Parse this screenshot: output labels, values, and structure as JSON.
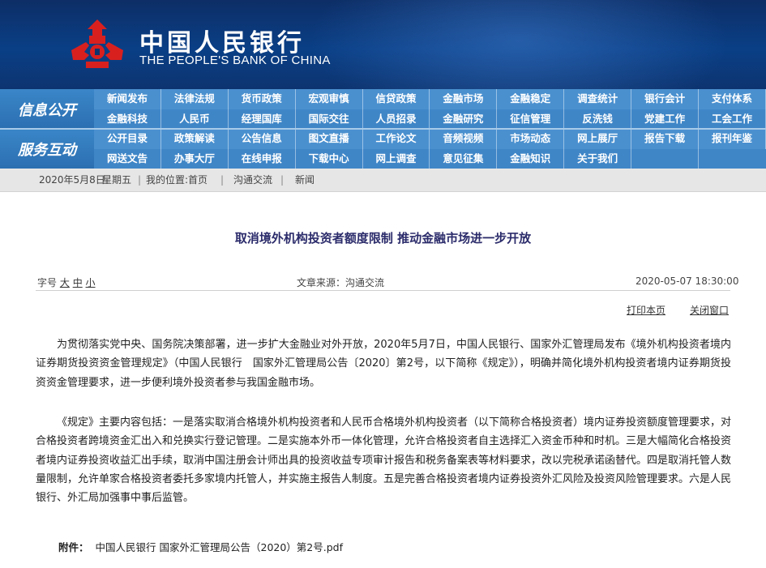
{
  "header": {
    "cn_name": "中国人民银行",
    "en_name": "THE PEOPLE'S BANK OF CHINA"
  },
  "nav": {
    "side_labels": [
      "信息公开",
      "服务互动"
    ],
    "rows": [
      [
        "新闻发布",
        "法律法规",
        "货币政策",
        "宏观审慎",
        "信贷政策",
        "金融市场",
        "金融稳定",
        "调查统计",
        "银行会计",
        "支付体系"
      ],
      [
        "金融科技",
        "人民币",
        "经理国库",
        "国际交往",
        "人员招录",
        "金融研究",
        "征信管理",
        "反洗钱",
        "党建工作",
        "工会工作"
      ],
      [
        "公开目录",
        "政策解读",
        "公告信息",
        "图文直播",
        "工作论文",
        "音频视频",
        "市场动态",
        "网上展厅",
        "报告下载",
        "报刊年鉴"
      ],
      [
        "网送文告",
        "办事大厅",
        "在线申报",
        "下载中心",
        "网上调查",
        "意见征集",
        "金融知识",
        "关于我们",
        "",
        ""
      ]
    ]
  },
  "breadcrumb": {
    "date": "2020年5月8日",
    "weekday": "星期五",
    "location_label": "我的位置:首页",
    "level1": "沟通交流",
    "level2": "新闻"
  },
  "article": {
    "title": "取消境外机构投资者额度限制 推动金融市场进一步开放",
    "font_label": "字号",
    "font_sizes": [
      "大",
      "中",
      "小"
    ],
    "source": "文章来源：沟通交流",
    "datetime": "2020-05-07 18:30:00",
    "print_label": "打印本页",
    "close_label": "关闭窗口",
    "paragraphs": [
      "为贯彻落实党中央、国务院决策部署，进一步扩大金融业对外开放，2020年5月7日，中国人民银行、国家外汇管理局发布《境外机构投资者境内证券期货投资资金管理规定》（中国人民银行　国家外汇管理局公告〔2020〕第2号，以下简称《规定》），明确并简化境外机构投资者境内证券期货投资资金管理要求，进一步便利境外投资者参与我国金融市场。",
      "《规定》主要内容包括：一是落实取消合格境外机构投资者和人民币合格境外机构投资者（以下简称合格投资者）境内证券投资额度管理要求，对合格投资者跨境资金汇出入和兑换实行登记管理。二是实施本外币一体化管理，允许合格投资者自主选择汇入资金币种和时机。三是大幅简化合格投资者境内证券投资收益汇出手续，取消中国注册会计师出具的投资收益专项审计报告和税务备案表等材料要求，改以完税承诺函替代。四是取消托管人数量限制，允许单家合格投资者委托多家境内托管人，并实施主报告人制度。五是完善合格投资者境内证券投资外汇风险及投资风险管理要求。六是人民银行、外汇局加强事中事后监管。"
    ],
    "attachment_label": "附件：",
    "attachment_file": "中国人民银行 国家外汇管理局公告（2020）第2号.pdf"
  },
  "colors": {
    "header_bg": "#0d3470",
    "nav_bg": "#4a90cf",
    "title_color": "#2b2b6b",
    "logo_red": "#d8201f"
  },
  "icons": [
    "pbc-logo-icon"
  ]
}
